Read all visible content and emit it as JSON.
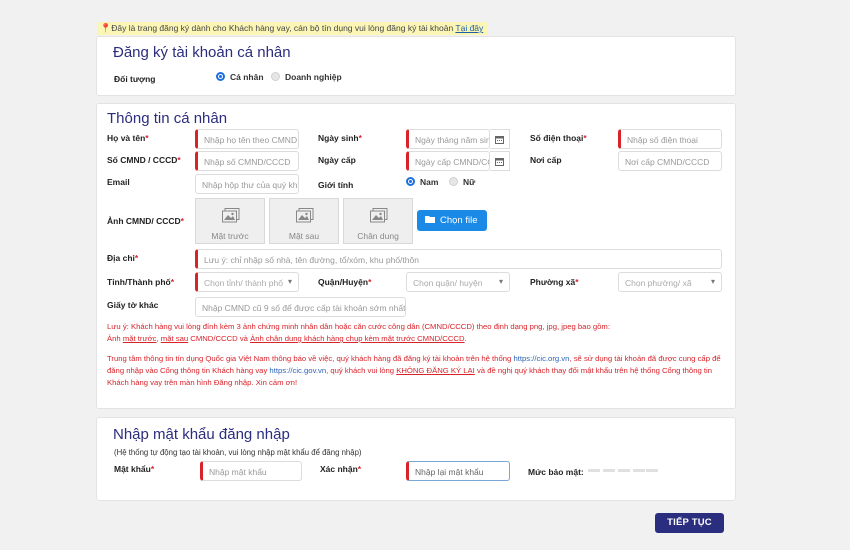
{
  "notice": {
    "text": "Đây là trang đăng ký dành cho Khách hàng vay, cán bộ tín dụng vui lòng đăng ký tài khoản ",
    "link": "Tại đây"
  },
  "account": {
    "title": "Đăng ký tài khoản cá nhân",
    "subject_label": "Đối tượng",
    "options": [
      "Cá nhân",
      "Doanh nghiệp"
    ],
    "selected": "Cá nhân"
  },
  "personal": {
    "title": "Thông tin cá nhân",
    "fullname": {
      "label": "Họ và tên",
      "placeholder": "Nhập họ tên theo CMND"
    },
    "dob": {
      "label": "Ngày sinh",
      "placeholder": "Ngày tháng năm sinh"
    },
    "phone": {
      "label": "Số điện thoại",
      "placeholder": "Nhập số điện thoại"
    },
    "id_number": {
      "label": "Số CMND / CCCD",
      "placeholder": "Nhập số CMND/CCCD"
    },
    "issue_date": {
      "label": "Ngày cấp",
      "placeholder": "Ngày cấp CMND/CCCD"
    },
    "issue_place": {
      "label": "Nơi cấp",
      "placeholder": "Nơi cấp CMND/CCCD"
    },
    "email": {
      "label": "Email",
      "placeholder": "Nhập hộp thư của quý khách"
    },
    "gender": {
      "label": "Giới tính",
      "options": [
        "Nam",
        "Nữ"
      ],
      "selected": "Nam"
    },
    "id_photo": {
      "label": "Ảnh CMND/ CCCD",
      "slots": [
        "Mặt trước",
        "Mặt sau",
        "Chân dung"
      ],
      "button": "Chọn file"
    },
    "address": {
      "label": "Địa chỉ",
      "placeholder": "Lưu ý: chỉ nhập số nhà, tên đường, tổ/xóm, khu phố/thôn"
    },
    "province": {
      "label": "Tỉnh/Thành phố",
      "placeholder": "Chọn tỉnh/ thành phố"
    },
    "district": {
      "label": "Quận/Huyện",
      "placeholder": "Chọn quận/ huyện"
    },
    "ward": {
      "label": "Phường xã",
      "placeholder": "Chọn phường/ xã"
    },
    "other_doc": {
      "label": "Giấy tờ khác",
      "placeholder": "Nhập CMND cũ 9 số để được cấp tài khoản sớm nhất"
    }
  },
  "notes": {
    "note1_a": "Lưu ý: Khách hàng vui lòng đính kèm 3 ảnh chứng minh nhân dân hoặc căn cước công dân (CMND/CCCD) theo định dạng png, jpg, jpeg bao gồm:",
    "note1_b1": "Ảnh ",
    "note1_b2": "mặt trước",
    "note1_b3": ", ",
    "note1_b4": "mặt sau",
    "note1_b5": " CMND/CCCD và ",
    "note1_b6": "Ảnh chân dung khách hàng chụp kèm mặt trước CMND/CCCD",
    "note1_b7": ".",
    "note2_a": "Trung tâm thông tin tín dụng Quốc gia Việt Nam thông báo về việc, quý khách hàng đã đăng ký tài khoản trên hệ thống ",
    "note2_link1": "https://cic.org.vn",
    "note2_b": ", sẽ sử dụng tài khoản đã được cung cấp để đăng nhập vào Cổng thông tin Khách hàng vay ",
    "note2_link2": "https://cic.gov.vn",
    "note2_c": ", quý khách vui lòng ",
    "note2_u": "KHÔNG ĐĂNG KÝ LẠI",
    "note2_d": " và đề nghị quý khách thay đổi mật khẩu trên hệ thống Cổng thông tin Khách hàng vay trên màn hình Đăng nhập. Xin cảm ơn!"
  },
  "password": {
    "title": "Nhập mật khẩu đăng nhập",
    "subtitle": "(Hệ thống tự động tạo tài khoản, vui lòng nhập mật khẩu để đăng nhập)",
    "pw": {
      "label": "Mật khẩu",
      "placeholder": "Nhập mật khẩu"
    },
    "confirm": {
      "label": "Xác nhận",
      "placeholder": "Nhập lại mật khẩu"
    },
    "strength_label": "Mức bảo mật:"
  },
  "submit_label": "TIẾP TỤC",
  "colors": {
    "accent": "#2b2d7e",
    "required": "#d8232a",
    "button_blue": "#1a8ae6",
    "notice_bg": "#fbf6b6"
  }
}
